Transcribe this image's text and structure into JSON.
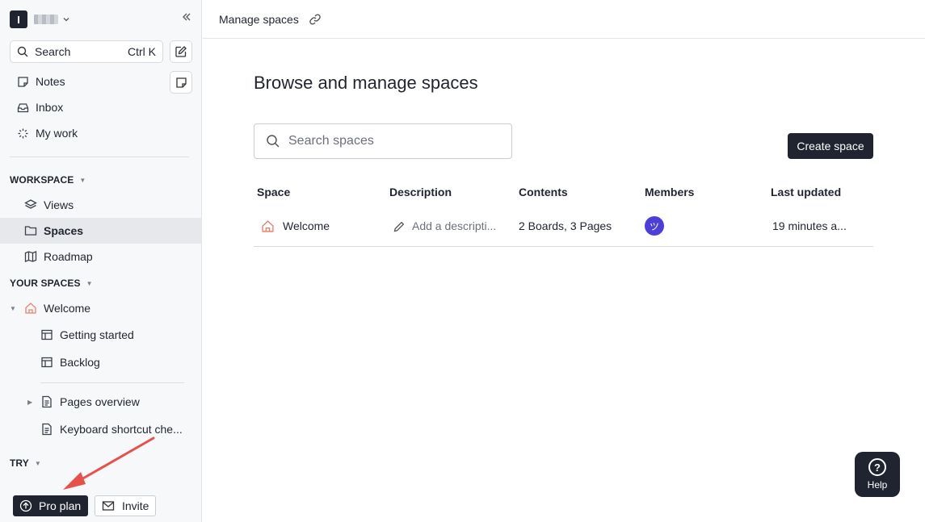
{
  "sidebar": {
    "workspace": {
      "avatar_letter": "I"
    },
    "search": {
      "label": "Search",
      "shortcut": "Ctrl K"
    },
    "nav": [
      {
        "label": "Notes",
        "icon": "note-icon"
      },
      {
        "label": "Inbox",
        "icon": "inbox-icon"
      },
      {
        "label": "My work",
        "icon": "spinner-icon"
      }
    ],
    "workspace_section": {
      "title": "WORKSPACE",
      "items": [
        {
          "label": "Views",
          "icon": "layers-icon"
        },
        {
          "label": "Spaces",
          "icon": "folder-icon",
          "active": true
        },
        {
          "label": "Roadmap",
          "icon": "map-icon"
        }
      ]
    },
    "your_spaces": {
      "title": "YOUR SPACES",
      "space": {
        "label": "Welcome",
        "icon": "home-icon"
      },
      "children": [
        {
          "label": "Getting started",
          "icon": "table-icon"
        },
        {
          "label": "Backlog",
          "icon": "table-icon"
        },
        {
          "label": "Pages overview",
          "icon": "page-icon"
        },
        {
          "label": "Keyboard shortcut che...",
          "icon": "page-icon"
        }
      ]
    },
    "try_section": {
      "title": "TRY"
    },
    "pro_plan_label": "Pro plan",
    "invite_label": "Invite"
  },
  "topbar": {
    "title": "Manage spaces"
  },
  "main": {
    "title": "Browse and manage spaces",
    "search_placeholder": "Search spaces",
    "create_label": "Create space",
    "table": {
      "headers": [
        "Space",
        "Description",
        "Contents",
        "Members",
        "Last updated"
      ],
      "rows": [
        {
          "space": "Welcome",
          "description": "Add a descripti...",
          "contents": "2 Boards, 3 Pages",
          "member_initial": "ツ",
          "last_updated": "19 minutes a..."
        }
      ]
    }
  },
  "help": {
    "label": "Help",
    "glyph": "?"
  },
  "colors": {
    "dark": "#1f2430",
    "accent_home": "#e8836b",
    "member_avatar": "#4a3fd8",
    "annotation_arrow": "#e8504a"
  }
}
